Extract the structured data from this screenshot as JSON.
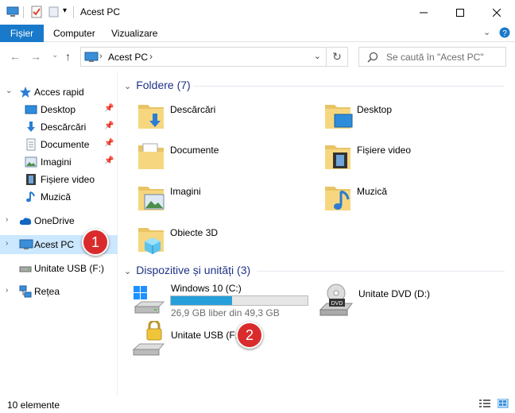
{
  "window": {
    "title": "Acest PC"
  },
  "ribbon": {
    "file_tab": "Fișier",
    "tabs": [
      "Computer",
      "Vizualizare"
    ]
  },
  "address": {
    "path": "Acest PC",
    "search_placeholder": "Se caută în \"Acest PC\""
  },
  "sidebar": {
    "quick_access": "Acces rapid",
    "items": [
      "Desktop",
      "Descărcări",
      "Documente",
      "Imagini",
      "Fișiere video",
      "Muzică"
    ],
    "onedrive": "OneDrive",
    "this_pc": "Acest PC",
    "usb": "Unitate USB (F:)",
    "network": "Rețea"
  },
  "folders": {
    "heading": "Foldere (7)",
    "items": [
      "Descărcări",
      "Desktop",
      "Documente",
      "Fișiere video",
      "Imagini",
      "Muzică",
      "Obiecte 3D"
    ]
  },
  "devices": {
    "heading": "Dispozitive și unități (3)",
    "c_drive": {
      "name": "Windows 10 (C:)",
      "free_text": "26,9 GB liber din 49,3 GB",
      "used_fraction": 0.45
    },
    "dvd": {
      "name": "Unitate DVD (D:)",
      "badge_text": "DVD"
    },
    "usb": {
      "name": "Unitate USB (F:)"
    }
  },
  "badges": [
    "1",
    "2"
  ],
  "status": {
    "count": "10 elemente"
  },
  "colors": {
    "accent": "#1979ca",
    "selection": "#cce8ff",
    "heading": "#1e3287",
    "badge": "#d92b2b"
  }
}
